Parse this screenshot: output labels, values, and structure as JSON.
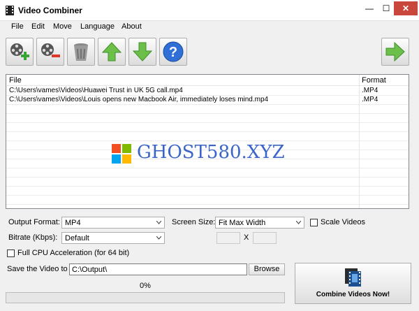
{
  "window": {
    "title": "Video Combiner",
    "minimize": "—",
    "maximize": "☐",
    "close": "✕"
  },
  "menu": [
    "File",
    "Edit",
    "Move",
    "Language",
    "About"
  ],
  "toolbar": {
    "buttons": [
      "add-video",
      "remove-video",
      "clear-list",
      "move-up",
      "move-down",
      "help"
    ],
    "next": "next"
  },
  "filelist": {
    "headers": {
      "file": "File",
      "format": "Format"
    },
    "rows": [
      {
        "file": "C:\\Users\\vames\\Videos\\Huawei  Trust in UK 5G call.mp4",
        "format": ".MP4"
      },
      {
        "file": "C:\\Users\\vames\\Videos\\Louis opens new Macbook Air, immediately loses mind.mp4",
        "format": ".MP4"
      }
    ]
  },
  "watermark": {
    "text": "GHOST580.XYZ"
  },
  "settings": {
    "output_format_label": "Output Format:",
    "output_format_value": "MP4",
    "screen_size_label": "Screen Size:",
    "screen_size_value": "Fit Max Width",
    "scale_videos_label": "Scale Videos",
    "scale_videos_checked": false,
    "bitrate_label": "Bitrate (Kbps):",
    "bitrate_value": "Default",
    "size_separator": "X",
    "full_cpu_label": "Full CPU Acceleration (for 64 bit)",
    "full_cpu_checked": false
  },
  "save": {
    "label": "Save the Video to",
    "path": "C:\\Output\\",
    "browse_label": "Browse"
  },
  "progress": {
    "percent_text": "0%",
    "value": 0
  },
  "combine": {
    "label": "Combine Videos Now!"
  },
  "colors": {
    "progress": "#06b025",
    "close": "#c8463b",
    "watermark": "#3a64c8"
  }
}
